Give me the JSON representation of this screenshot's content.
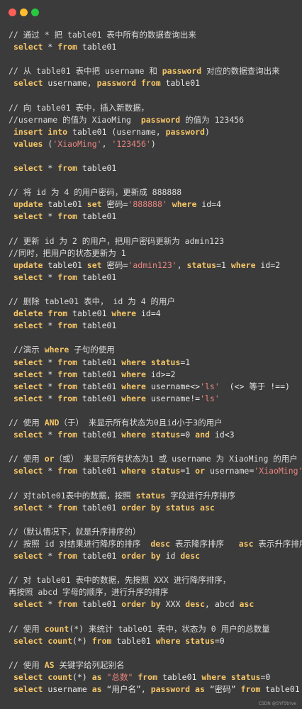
{
  "window": {
    "controls": [
      "close",
      "minimize",
      "maximize"
    ]
  },
  "colors": {
    "keyword": "#f6c667",
    "string": "#e8857f",
    "comment": "#dcdcdc",
    "text": "#e6e6e6",
    "background": "#3b3b3b"
  },
  "lines": [
    [
      [
        "c",
        "// 通过 * 把 table01 表中所有的数据查询出来"
      ]
    ],
    [
      [
        "t",
        " "
      ],
      [
        "k",
        "select"
      ],
      [
        "t",
        " * "
      ],
      [
        "k",
        "from"
      ],
      [
        "t",
        " table01"
      ]
    ],
    [],
    [
      [
        "c",
        "// 从 table01 表中把 username 和 "
      ],
      [
        "k",
        "password"
      ],
      [
        "c",
        " 对应的数据查询出来"
      ]
    ],
    [
      [
        "t",
        " "
      ],
      [
        "k",
        "select"
      ],
      [
        "t",
        " username, "
      ],
      [
        "k",
        "password"
      ],
      [
        "t",
        " "
      ],
      [
        "k",
        "from"
      ],
      [
        "t",
        " table01"
      ]
    ],
    [],
    [
      [
        "c",
        "// 向 table01 表中，插入新数据，"
      ]
    ],
    [
      [
        "c",
        "//username 的值为 XiaoMing  "
      ],
      [
        "k",
        "password"
      ],
      [
        "c",
        " 的值为 123456"
      ]
    ],
    [
      [
        "t",
        " "
      ],
      [
        "k",
        "insert into"
      ],
      [
        "t",
        " table01 (username, "
      ],
      [
        "k",
        "password"
      ],
      [
        "t",
        ")"
      ]
    ],
    [
      [
        "t",
        " "
      ],
      [
        "k",
        "values"
      ],
      [
        "t",
        " ("
      ],
      [
        "s",
        "'XiaoMing'"
      ],
      [
        "t",
        ", "
      ],
      [
        "s",
        "'123456'"
      ],
      [
        "t",
        ")"
      ]
    ],
    [],
    [
      [
        "t",
        " "
      ],
      [
        "k",
        "select"
      ],
      [
        "t",
        " * "
      ],
      [
        "k",
        "from"
      ],
      [
        "t",
        " table01"
      ]
    ],
    [],
    [
      [
        "c",
        "// 将 id 为 4 的用户密码，更新成 888888"
      ]
    ],
    [
      [
        "t",
        " "
      ],
      [
        "k",
        "update"
      ],
      [
        "t",
        " table01 "
      ],
      [
        "k",
        "set"
      ],
      [
        "t",
        " 密码="
      ],
      [
        "s",
        "'888888'"
      ],
      [
        "t",
        " "
      ],
      [
        "k",
        "where"
      ],
      [
        "t",
        " id=4"
      ]
    ],
    [
      [
        "t",
        " "
      ],
      [
        "k",
        "select"
      ],
      [
        "t",
        " * "
      ],
      [
        "k",
        "from"
      ],
      [
        "t",
        " table01"
      ]
    ],
    [],
    [
      [
        "c",
        "// 更新 id 为 2 的用户，把用户密码更新为 admin123"
      ]
    ],
    [
      [
        "c",
        "//同时，把用户的状态更新为 1"
      ]
    ],
    [
      [
        "t",
        " "
      ],
      [
        "k",
        "update"
      ],
      [
        "t",
        " table01 "
      ],
      [
        "k",
        "set"
      ],
      [
        "t",
        " 密码="
      ],
      [
        "s",
        "'admin123'"
      ],
      [
        "t",
        ", "
      ],
      [
        "k",
        "status"
      ],
      [
        "t",
        "=1 "
      ],
      [
        "k",
        "where"
      ],
      [
        "t",
        " id=2"
      ]
    ],
    [
      [
        "t",
        " "
      ],
      [
        "k",
        "select"
      ],
      [
        "t",
        " * "
      ],
      [
        "k",
        "from"
      ],
      [
        "t",
        " table01"
      ]
    ],
    [],
    [
      [
        "c",
        "// 删除 table01 表中， id 为 4 的用户"
      ]
    ],
    [
      [
        "t",
        " "
      ],
      [
        "k",
        "delete from"
      ],
      [
        "t",
        " table01 "
      ],
      [
        "k",
        "where"
      ],
      [
        "t",
        " id=4"
      ]
    ],
    [
      [
        "t",
        " "
      ],
      [
        "k",
        "select"
      ],
      [
        "t",
        " * "
      ],
      [
        "k",
        "from"
      ],
      [
        "t",
        " table01"
      ]
    ],
    [],
    [
      [
        "c",
        " //演示 "
      ],
      [
        "k",
        "where"
      ],
      [
        "c",
        " 子句的使用"
      ]
    ],
    [
      [
        "t",
        " "
      ],
      [
        "k",
        "select"
      ],
      [
        "t",
        " * "
      ],
      [
        "k",
        "from"
      ],
      [
        "t",
        " table01 "
      ],
      [
        "k",
        "where status"
      ],
      [
        "t",
        "=1"
      ]
    ],
    [
      [
        "t",
        " "
      ],
      [
        "k",
        "select"
      ],
      [
        "t",
        " * "
      ],
      [
        "k",
        "from"
      ],
      [
        "t",
        " table01 "
      ],
      [
        "k",
        "where"
      ],
      [
        "t",
        " id>=2"
      ]
    ],
    [
      [
        "t",
        " "
      ],
      [
        "k",
        "select"
      ],
      [
        "t",
        " * "
      ],
      [
        "k",
        "from"
      ],
      [
        "t",
        " table01 "
      ],
      [
        "k",
        "where"
      ],
      [
        "t",
        " username<>"
      ],
      [
        "s",
        "'ls'"
      ],
      [
        "t",
        "  (<> 等于 !==)"
      ]
    ],
    [
      [
        "t",
        " "
      ],
      [
        "k",
        "select"
      ],
      [
        "t",
        " * "
      ],
      [
        "k",
        "from"
      ],
      [
        "t",
        " table01 "
      ],
      [
        "k",
        "where"
      ],
      [
        "t",
        " username!="
      ],
      [
        "s",
        "'ls'"
      ]
    ],
    [],
    [
      [
        "c",
        "// 使用 "
      ],
      [
        "k",
        "AND"
      ],
      [
        "c",
        "（于） 来显示所有状态为0且id小于3的用户"
      ]
    ],
    [
      [
        "t",
        " "
      ],
      [
        "k",
        "select"
      ],
      [
        "t",
        " * "
      ],
      [
        "k",
        "from"
      ],
      [
        "t",
        " table01 "
      ],
      [
        "k",
        "where status"
      ],
      [
        "t",
        "=0 "
      ],
      [
        "k",
        "and"
      ],
      [
        "t",
        " id<3"
      ]
    ],
    [],
    [
      [
        "c",
        "// 使用 "
      ],
      [
        "k",
        "or"
      ],
      [
        "c",
        "（或） 来显示所有状态为1 或 username 为 XiaoMing 的用户"
      ]
    ],
    [
      [
        "t",
        " "
      ],
      [
        "k",
        "select"
      ],
      [
        "t",
        " * "
      ],
      [
        "k",
        "from"
      ],
      [
        "t",
        " table01 "
      ],
      [
        "k",
        "where status"
      ],
      [
        "t",
        "=1 "
      ],
      [
        "k",
        "or"
      ],
      [
        "t",
        " username="
      ],
      [
        "s",
        "'XiaoMing'"
      ]
    ],
    [],
    [
      [
        "c",
        "// 对table01表中的数据，按照 "
      ],
      [
        "k",
        "status"
      ],
      [
        "c",
        " 字段进行升序排序"
      ]
    ],
    [
      [
        "t",
        " "
      ],
      [
        "k",
        "select"
      ],
      [
        "t",
        " * "
      ],
      [
        "k",
        "from"
      ],
      [
        "t",
        " table01 "
      ],
      [
        "k",
        "order by status asc"
      ]
    ],
    [],
    [
      [
        "c",
        "//（默认情况下，就是升序排序的）"
      ]
    ],
    [
      [
        "c",
        "// 按照 id 对结果进行降序的排序  "
      ],
      [
        "k",
        "desc"
      ],
      [
        "c",
        " 表示降序排序   "
      ],
      [
        "k",
        "asc"
      ],
      [
        "c",
        " 表示升序排序"
      ]
    ],
    [
      [
        "t",
        " "
      ],
      [
        "k",
        "select"
      ],
      [
        "t",
        " * "
      ],
      [
        "k",
        "from"
      ],
      [
        "t",
        " table01 "
      ],
      [
        "k",
        "order by"
      ],
      [
        "t",
        " id "
      ],
      [
        "k",
        "desc"
      ]
    ],
    [],
    [
      [
        "c",
        "// 对 table01 表中的数据，先按照 XXX 进行降序排序，"
      ]
    ],
    [
      [
        "c",
        "再按照 abcd 字母的顺序，进行升序的排序"
      ]
    ],
    [
      [
        "t",
        " "
      ],
      [
        "k",
        "select"
      ],
      [
        "t",
        " * "
      ],
      [
        "k",
        "from"
      ],
      [
        "t",
        " table01 "
      ],
      [
        "k",
        "order by"
      ],
      [
        "t",
        " XXX "
      ],
      [
        "k",
        "desc"
      ],
      [
        "t",
        ", abcd "
      ],
      [
        "k",
        "asc"
      ]
    ],
    [],
    [
      [
        "c",
        "// 使用 "
      ],
      [
        "k",
        "count"
      ],
      [
        "c",
        "(*) 来统计 table01 表中，状态为 0 用户的总数量"
      ]
    ],
    [
      [
        "t",
        " "
      ],
      [
        "k",
        "select count"
      ],
      [
        "t",
        "(*) "
      ],
      [
        "k",
        "from"
      ],
      [
        "t",
        " table01 "
      ],
      [
        "k",
        "where status"
      ],
      [
        "t",
        "=0"
      ]
    ],
    [],
    [
      [
        "c",
        "// 使用 "
      ],
      [
        "k",
        "AS"
      ],
      [
        "c",
        " 关键字给列起别名"
      ]
    ],
    [
      [
        "t",
        " "
      ],
      [
        "k",
        "select count"
      ],
      [
        "t",
        "(*) "
      ],
      [
        "k",
        "as"
      ],
      [
        "t",
        " "
      ],
      [
        "s",
        "\"总数\""
      ],
      [
        "t",
        " "
      ],
      [
        "k",
        "from"
      ],
      [
        "t",
        " table01 "
      ],
      [
        "k",
        "where status"
      ],
      [
        "t",
        "=0"
      ]
    ],
    [
      [
        "t",
        " "
      ],
      [
        "k",
        "select"
      ],
      [
        "t",
        " username "
      ],
      [
        "k",
        "as"
      ],
      [
        "t",
        " “用户名”, "
      ],
      [
        "k",
        "password as"
      ],
      [
        "t",
        " “密码” "
      ],
      [
        "k",
        "from"
      ],
      [
        "t",
        " table01"
      ]
    ]
  ],
  "watermark": "CSDN @SYFStrive"
}
